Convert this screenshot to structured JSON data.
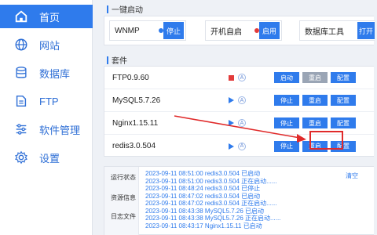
{
  "nav": [
    {
      "label": "首页",
      "icon": "home-icon"
    },
    {
      "label": "网站",
      "icon": "globe-icon"
    },
    {
      "label": "数据库",
      "icon": "database-icon"
    },
    {
      "label": "FTP",
      "icon": "folder-icon"
    },
    {
      "label": "软件管理",
      "icon": "sliders-icon"
    },
    {
      "label": "设置",
      "icon": "gear-icon"
    }
  ],
  "quick": {
    "title": "一键启动",
    "items": [
      {
        "name": "WNMP",
        "button": "停止",
        "dot_color": "#2f7bec"
      },
      {
        "name": "开机自启",
        "button": "启用",
        "dot_color": "#e23b3b"
      },
      {
        "name": "数据库工具",
        "button": "打开"
      }
    ]
  },
  "suite": {
    "title": "套件",
    "rows": [
      {
        "name": "FTP0.9.60",
        "state": "stopped",
        "b1": "启动",
        "b2": "重启",
        "b3": "配置",
        "b2_disabled": true
      },
      {
        "name": "MySQL5.7.26",
        "state": "running",
        "b1": "停止",
        "b2": "重启",
        "b3": "配置"
      },
      {
        "name": "Nginx1.15.11",
        "state": "running",
        "b1": "停止",
        "b2": "重启",
        "b3": "配置"
      },
      {
        "name": "redis3.0.504",
        "state": "running",
        "b1": "停止",
        "b2": "重启",
        "b3": "配置"
      }
    ],
    "auto_symbol": "A"
  },
  "log": {
    "tabs": [
      "运行状态",
      "资源信息",
      "日志文件"
    ],
    "clear": "清空",
    "lines": [
      "2023-09-11 08:51:00 redis3.0.504 已启动",
      "2023-09-11 08:51:00 redis3.0.504 正在启动......",
      "2023-09-11 08:48:24 redis3.0.504 已停止",
      "2023-09-11 08:47:02 redis3.0.504 已启动",
      "2023-09-11 08:47:02 redis3.0.504 正在启动......",
      "2023-09-11 08:43:38 MySQL5.7.26 已启动",
      "2023-09-11 08:43:38 MySQL5.7.26 正在启动......",
      "2023-09-11 08:43:17 Nginx1.15.11 已启动"
    ]
  },
  "colors": {
    "accent": "#2f7bec",
    "stopped": "#e23b3b",
    "annotation": "#e02a2a"
  }
}
